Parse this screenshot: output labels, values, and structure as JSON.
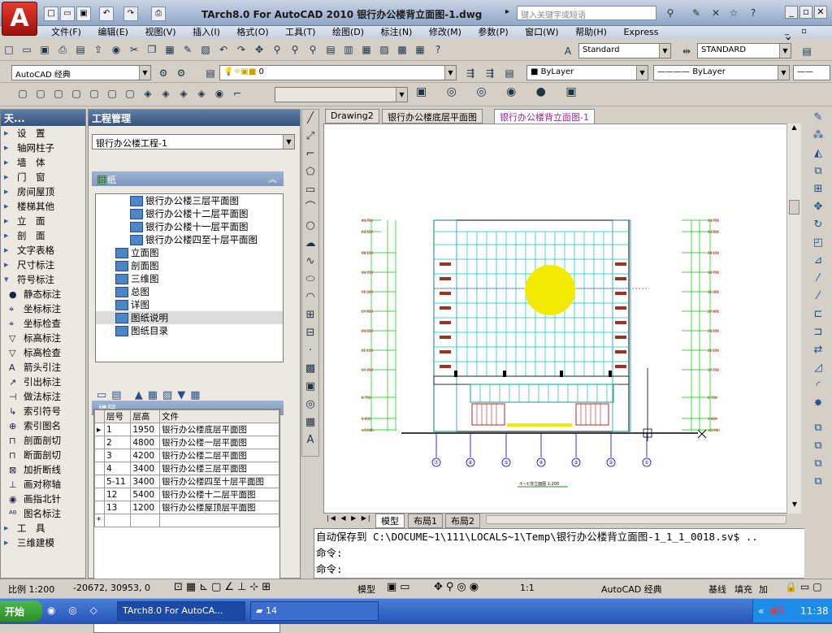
{
  "title": {
    "text": "TArch8.0 For AutoCAD 2010  银行办公楼背立面图-1.dwg",
    "search_placeholder": "键入关键字或短语"
  },
  "menu": [
    "文件(F)",
    "编辑(E)",
    "视图(V)",
    "插入(I)",
    "格式(O)",
    "工具(T)",
    "绘图(D)",
    "标注(N)",
    "修改(M)",
    "参数(P)",
    "窗口(W)",
    "帮助(H)",
    "Express"
  ],
  "toolbar": {
    "text_style": "Standard",
    "dim_style": "STANDARD",
    "workspace": "AutoCAD 经典",
    "layer": "0",
    "color": "ByLayer",
    "linetype": "ByLayer"
  },
  "left_panel": {
    "title": "天...",
    "items": [
      {
        "label": "设　置",
        "expandable": true
      },
      {
        "label": "轴网柱子",
        "expandable": true
      },
      {
        "label": "墙　体",
        "expandable": true
      },
      {
        "label": "门　窗",
        "expandable": true
      },
      {
        "label": "房间屋顶",
        "expandable": true
      },
      {
        "label": "楼梯其他",
        "expandable": true
      },
      {
        "label": "立　面",
        "expandable": true
      },
      {
        "label": "剖　面",
        "expandable": true
      },
      {
        "label": "文字表格",
        "expandable": true
      },
      {
        "label": "尺寸标注",
        "expandable": true
      },
      {
        "label": "符号标注",
        "expandable": true,
        "expanded": true
      },
      {
        "label": "静态标注",
        "icon": "static-mark-icon"
      },
      {
        "label": "坐标标注",
        "icon": "coord-mark-icon"
      },
      {
        "label": "坐标检查",
        "icon": "coord-check-icon"
      },
      {
        "label": "标高标注",
        "icon": "elevation-mark-icon"
      },
      {
        "label": "标高检查",
        "icon": "elevation-check-icon"
      },
      {
        "label": "箭头引注",
        "icon": "arrow-leader-icon"
      },
      {
        "label": "引出标注",
        "icon": "leader-note-icon"
      },
      {
        "label": "做法标注",
        "icon": "method-note-icon"
      },
      {
        "label": "索引符号",
        "icon": "index-symbol-icon"
      },
      {
        "label": "索引图名",
        "icon": "index-name-icon"
      },
      {
        "label": "剖面剖切",
        "icon": "section-cut-icon"
      },
      {
        "label": "断面剖切",
        "icon": "break-cut-icon"
      },
      {
        "label": "加折断线",
        "icon": "break-line-icon"
      },
      {
        "label": "画对称轴",
        "icon": "symmetry-axis-icon"
      },
      {
        "label": "画指北针",
        "icon": "north-arrow-icon"
      },
      {
        "label": "图名标注",
        "icon": "drawing-title-icon"
      },
      {
        "label": "工　具",
        "expandable": true
      },
      {
        "label": "三维建模",
        "expandable": true
      }
    ]
  },
  "project": {
    "title": "工程管理",
    "project_name": "银行办公楼工程-1",
    "drawings_section": "图纸",
    "tree": [
      "银行办公楼三层平面图",
      "银行办公楼十二层平面图",
      "银行办公楼十一层平面图",
      "银行办公楼四至十层平面图",
      "立面图",
      "剖面图",
      "三维图",
      "总图",
      "详图",
      "图纸说明",
      "图纸目录"
    ],
    "floors_section": "楼层",
    "floor_headers": [
      "层号",
      "层高",
      "文件"
    ],
    "floors": [
      [
        "1",
        "1950",
        "银行办公楼底层平面图"
      ],
      [
        "2",
        "4800",
        "银行办公楼一层平面图"
      ],
      [
        "3",
        "4200",
        "银行办公楼二层平面图"
      ],
      [
        "4",
        "3400",
        "银行办公楼三层平面图"
      ],
      [
        "5-11",
        "3400",
        "银行办公楼四至十层平面图"
      ],
      [
        "12",
        "5400",
        "银行办公楼十二层平面图"
      ],
      [
        "13",
        "1200",
        "银行办公楼屋顶层平面图"
      ]
    ]
  },
  "doc_tabs": [
    "Drawing2",
    "银行办公楼底层平面图",
    "银行办公楼背立面图-1"
  ],
  "drawing": {
    "axis_labels": [
      "⑦",
      "⑥",
      "⑤",
      "④",
      "③",
      "②",
      "①"
    ],
    "caption": "⑦~①背立面图 1:200"
  },
  "layout_tabs": [
    "模型",
    "布局1",
    "布局2"
  ],
  "command": {
    "line1": "自动保存到 C:\\DOCUME~1\\111\\LOCALS~1\\Temp\\银行办公楼背立面图-1_1_1_0018.sv$ ..",
    "line2": "命令:",
    "line3": "命令:"
  },
  "status": {
    "scale": "比例 1:200",
    "coords": "-20672, 30953, 0",
    "model": "模型",
    "anno_scale": "1:1",
    "workspace": "AutoCAD 经典",
    "baseline": "基线",
    "fill": "填充",
    "extra": "加"
  },
  "taskbar": {
    "start": "开始",
    "tasks": [
      "TArch8.0 For AutoCA...",
      "14"
    ],
    "time": "11:38"
  },
  "colors": {
    "accent": "#a0259c",
    "title_blue": "#36527b",
    "task_blue": "#2553b8"
  }
}
